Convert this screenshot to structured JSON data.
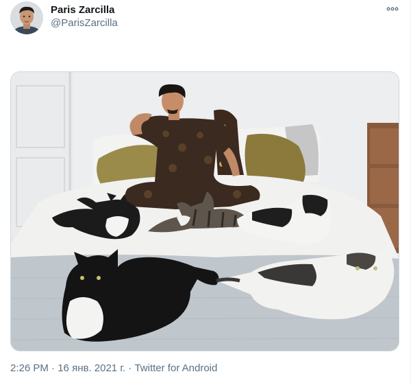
{
  "author": {
    "display_name": "Paris Zarcilla",
    "handle": "@ParisZarcilla",
    "avatar_icon": "profile-photo"
  },
  "more_icon": "more-dots-icon",
  "media": {
    "kind": "photo"
  },
  "meta": {
    "time": "2:26 PM",
    "separator": " · ",
    "date": "16 янв. 2021 г.",
    "source": "Twitter for Android"
  },
  "colors": {
    "name": "#0f1419",
    "secondary": "#5b7083",
    "border": "#cfd9de"
  }
}
